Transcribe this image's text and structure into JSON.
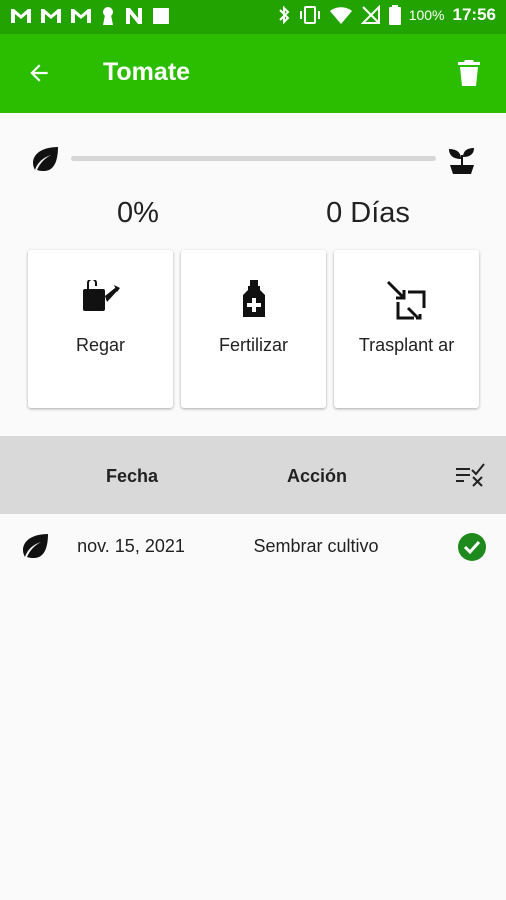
{
  "status_bar": {
    "battery": "100%",
    "time": "17:56"
  },
  "app_bar": {
    "title": "Tomate"
  },
  "progress": {
    "percent_label": "0%",
    "percent_value": 0,
    "days_label": "0 Días"
  },
  "actions": [
    {
      "label": "Regar",
      "icon": "watering-can-icon"
    },
    {
      "label": "Fertilizar",
      "icon": "fertilizer-bottle-icon"
    },
    {
      "label": "Trasplant ar",
      "icon": "transplant-icon"
    }
  ],
  "table": {
    "headers": {
      "date": "Fecha",
      "action": "Acción"
    },
    "rows": [
      {
        "date": "nov. 15, 2021",
        "action": "Sembrar cultivo",
        "icon": "seed-icon",
        "status": "done"
      }
    ]
  },
  "colors": {
    "status_bar": "#23a301",
    "app_bar": "#2bbd00",
    "check": "#1e8a1e"
  }
}
